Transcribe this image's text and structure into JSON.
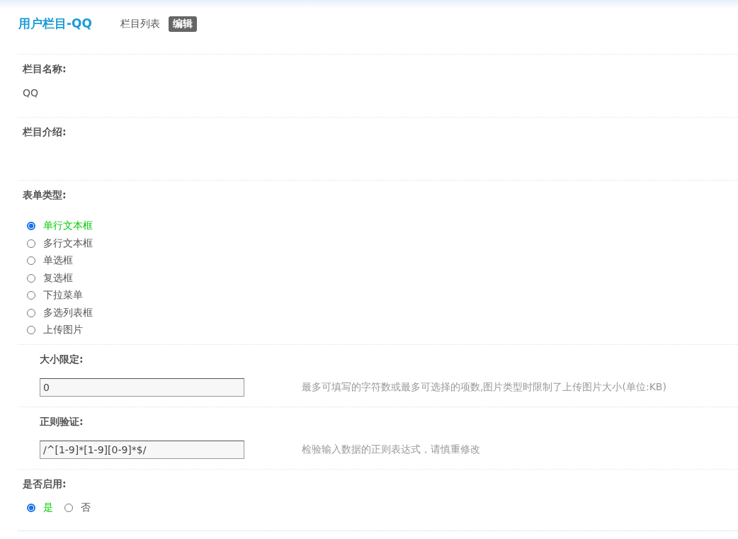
{
  "header": {
    "title": "用户栏目-QQ",
    "nav": [
      {
        "label": "栏目列表",
        "selected": false
      },
      {
        "label": "编辑",
        "selected": true
      }
    ]
  },
  "sections": [
    {
      "kind": "text",
      "label": "栏目名称:",
      "value": "QQ"
    },
    {
      "kind": "text",
      "label": "栏目介绍:"
    },
    {
      "kind": "radio",
      "label": "表单类型:",
      "options": [
        {
          "label": "单行文本框",
          "selected": true
        },
        {
          "label": "多行文本框",
          "selected": false
        },
        {
          "label": "单选框",
          "selected": false
        },
        {
          "label": "复选框",
          "selected": false
        },
        {
          "label": "下拉菜单",
          "selected": false
        },
        {
          "label": "多选列表框",
          "selected": false
        },
        {
          "label": "上传图片",
          "selected": false
        }
      ]
    },
    {
      "kind": "input",
      "label": "大小限定:",
      "value": "0",
      "hint": "最多可填写的字符数或最多可选择的项数,图片类型时限制了上传图片大小(单位:KB)"
    },
    {
      "kind": "input",
      "label": "正则验证:",
      "value": "/^[1-9]*[1-9][0-9]*$/",
      "hint": "检验输入数据的正则表达式，请慎重修改"
    },
    {
      "kind": "radio_inline",
      "label": "是否启用:",
      "options": [
        {
          "label": "是",
          "selected": true
        },
        {
          "label": "否",
          "selected": false
        }
      ]
    }
  ]
}
